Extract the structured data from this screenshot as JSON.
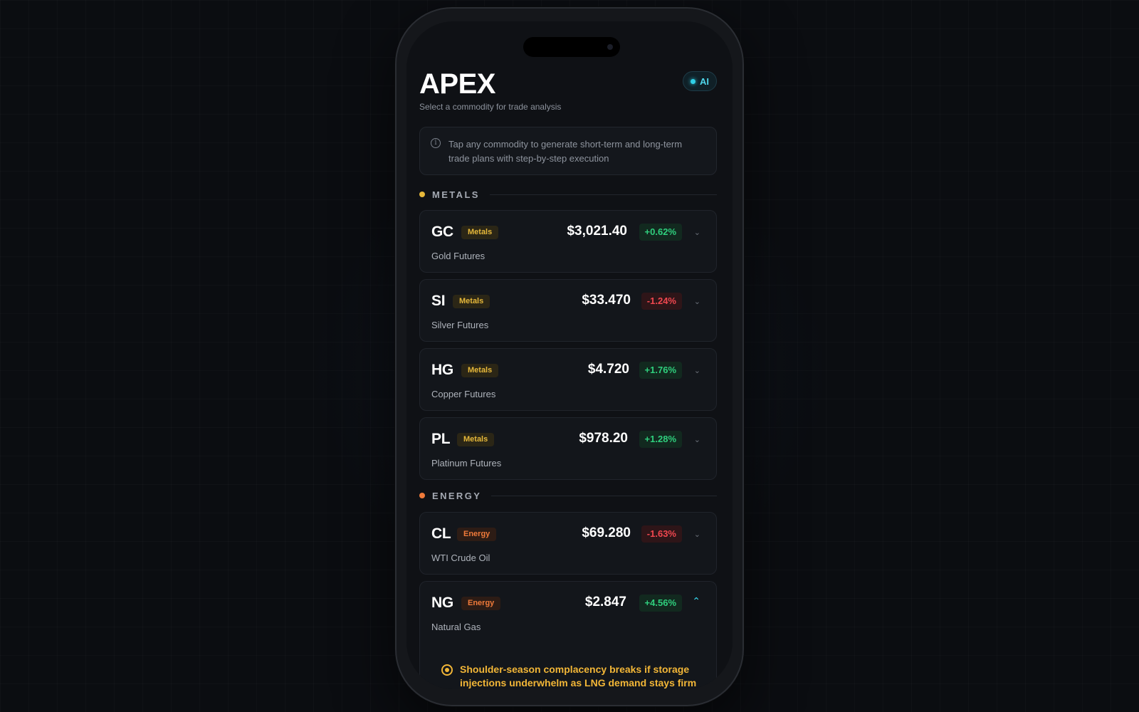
{
  "header": {
    "brand": "APEX",
    "subtitle": "Select a commodity for trade analysis",
    "ai_badge": "AI"
  },
  "info_banner": {
    "icon": "info-icon",
    "line1": "Tap any commodity to generate short-term and long-term",
    "line2": "trade plans with step-by-step execution"
  },
  "colors": {
    "metals": "#e6b83a",
    "energy": "#ef7a3a",
    "positive": "#2fcf7d",
    "negative": "#f0474f",
    "accent": "#36d5ec"
  },
  "sections": [
    {
      "label": "METALS",
      "items": [
        {
          "symbol": "GC",
          "tag": "Metals",
          "price": "$3,021.40",
          "change": "+0.62%",
          "direction": "up",
          "name": "Gold Futures"
        },
        {
          "symbol": "SI",
          "tag": "Metals",
          "price": "$33.470",
          "change": "-1.24%",
          "direction": "down",
          "name": "Silver Futures"
        },
        {
          "symbol": "HG",
          "tag": "Metals",
          "price": "$4.720",
          "change": "+1.76%",
          "direction": "up",
          "name": "Copper Futures"
        },
        {
          "symbol": "PL",
          "tag": "Metals",
          "price": "$978.20",
          "change": "+1.28%",
          "direction": "up",
          "name": "Platinum Futures"
        }
      ]
    },
    {
      "label": "ENERGY",
      "items": [
        {
          "symbol": "CL",
          "tag": "Energy",
          "price": "$69.280",
          "change": "-1.63%",
          "direction": "down",
          "name": "WTI Crude Oil"
        },
        {
          "symbol": "NG",
          "tag": "Energy",
          "price": "$2.847",
          "change": "+4.56%",
          "direction": "up",
          "name": "Natural Gas",
          "expanded": true,
          "thesis": "Shoulder-season complacency breaks if storage injections underwhelm as LNG demand stays firm"
        }
      ]
    }
  ]
}
